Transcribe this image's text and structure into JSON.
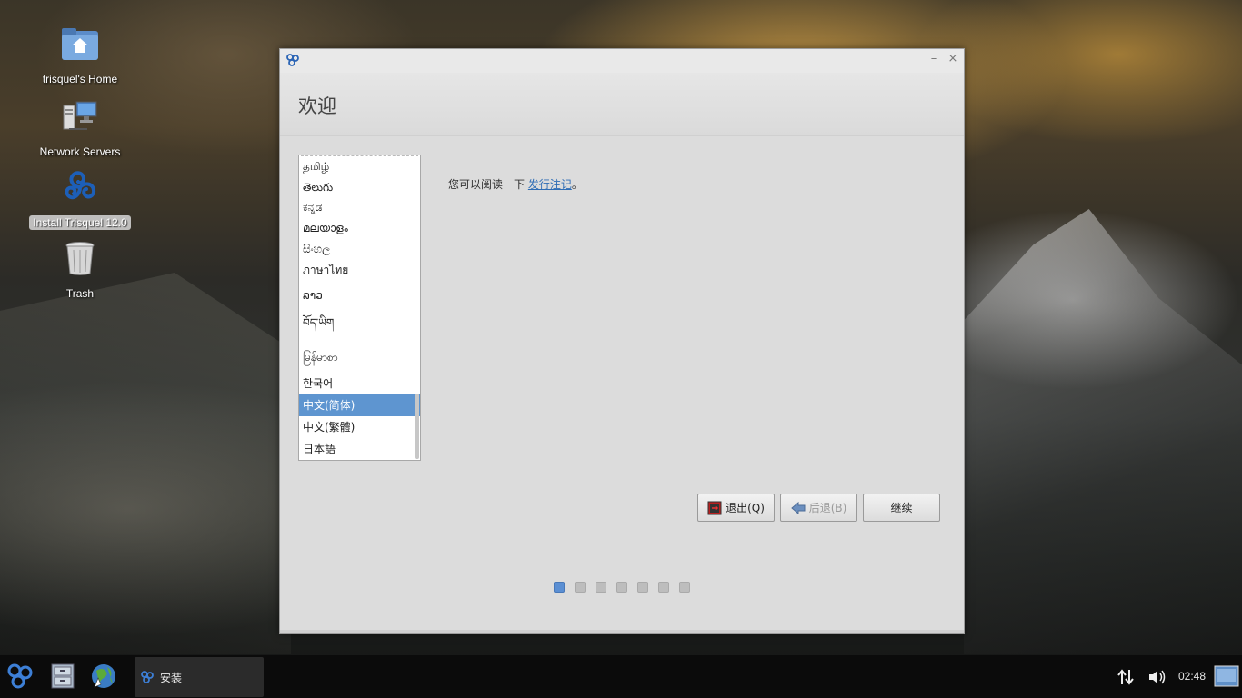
{
  "desktop": {
    "icons": [
      {
        "label": "trisquel's Home"
      },
      {
        "label": "Network Servers"
      },
      {
        "label": "Install Trisquel 12.0"
      },
      {
        "label": "Trash"
      }
    ]
  },
  "window": {
    "title": "欢迎",
    "minimize_glyph": "–",
    "close_glyph": "×",
    "languages": [
      "தமிழ்",
      "తెలుగు",
      "ಕನ್ನಡ",
      "മലയാളം",
      "සිංහල",
      "ภาษาไทย",
      "ລາວ",
      "བོད་ཡིག",
      "မြန်မာစာ",
      "한국어",
      "中文(简体)",
      "中文(繁體)",
      "日本語"
    ],
    "selected_language": "中文(简体)",
    "info_prefix": "您可以阅读一下 ",
    "info_link": "发行注记",
    "info_suffix": "。",
    "buttons": {
      "quit": "退出(Q)",
      "back": "后退(B)",
      "continue": "继续"
    },
    "steps_total": 7,
    "step_current": 1
  },
  "taskbar": {
    "task_label": "安装",
    "clock": "02:48"
  },
  "colors": {
    "accent": "#5e95d0",
    "link": "#2f6db5",
    "taskbar": "#0b0b0b"
  }
}
